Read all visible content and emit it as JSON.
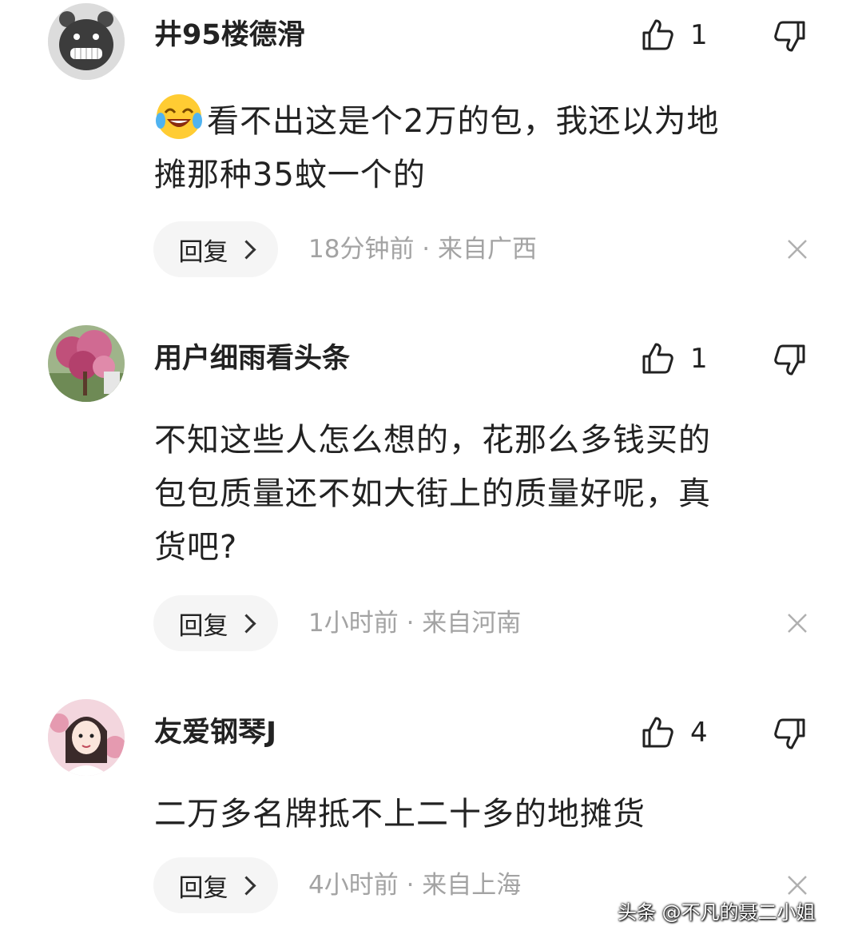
{
  "comments": [
    {
      "username": "井95楼德滑",
      "like_count": "1",
      "content_lines": [
        "看不出这是个2万的包，我还以为地",
        "摊那种35蚊一个的"
      ],
      "leading_emoji": "laugh-cry-emoji",
      "reply_label": "回复",
      "meta": "18分钟前 · 来自广西",
      "avatar": "gray-grinning-bear-avatar"
    },
    {
      "username": "用户细雨看头条",
      "like_count": "1",
      "content_lines": [
        "不知这些人怎么想的，花那么多钱买的",
        "包包质量还不如大街上的质量好呢，真",
        "货吧?"
      ],
      "reply_label": "回复",
      "meta": "1小时前 · 来自河南",
      "avatar": "pink-blossom-tree-avatar"
    },
    {
      "username": "友爱钢琴J",
      "like_count": "4",
      "content_lines": [
        "二万多名牌抵不上二十多的地摊货"
      ],
      "reply_label": "回复",
      "meta": "4小时前 · 来自上海",
      "avatar": "cartoon-girl-avatar"
    }
  ],
  "icons": {
    "like": "thumbs-up-icon",
    "dislike": "thumbs-down-icon",
    "close": "close-icon",
    "reply_chevron": "chevron-right-icon"
  },
  "watermark": "头条 @不凡的聂二小姐",
  "colors": {
    "text": "#222222",
    "meta": "#a3a3a3",
    "reply_bg": "#f5f5f5",
    "background": "#ffffff"
  }
}
